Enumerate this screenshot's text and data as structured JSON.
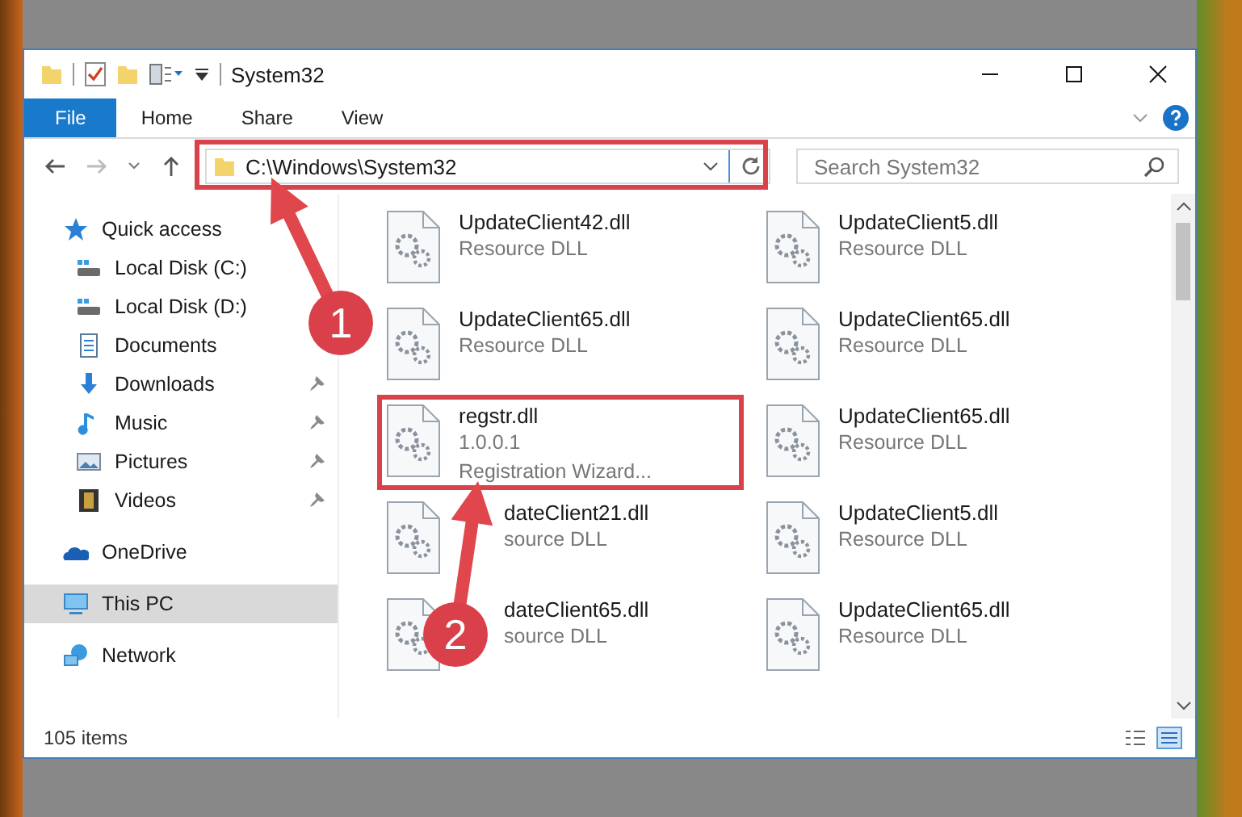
{
  "window": {
    "title": "System32"
  },
  "ribbon_tabs": [
    {
      "label": "File",
      "selected": true
    },
    {
      "label": "Home",
      "selected": false
    },
    {
      "label": "Share",
      "selected": false
    },
    {
      "label": "View",
      "selected": false
    }
  ],
  "address_bar": {
    "path": "C:\\Windows\\System32"
  },
  "search": {
    "placeholder": "Search System32"
  },
  "sidebar": {
    "items": [
      {
        "label": "Quick access",
        "kind": "star",
        "selected": false,
        "children": [
          {
            "label": "Local Disk (C:)",
            "kind": "drive",
            "pinned": false,
            "selected": false
          },
          {
            "label": "Local Disk (D:)",
            "kind": "drive",
            "pinned": false,
            "selected": false
          },
          {
            "label": "Documents",
            "kind": "documents",
            "pinned": false,
            "selected": false
          },
          {
            "label": "Downloads",
            "kind": "downloads",
            "pinned": true,
            "selected": false
          },
          {
            "label": "Music",
            "kind": "music",
            "pinned": true,
            "selected": false
          },
          {
            "label": "Pictures",
            "kind": "pictures",
            "pinned": true,
            "selected": false
          },
          {
            "label": "Videos",
            "kind": "videos",
            "pinned": true,
            "selected": false
          }
        ]
      },
      {
        "label": "OneDrive",
        "kind": "cloud",
        "selected": false
      },
      {
        "label": "This PC",
        "kind": "pc",
        "selected": true
      },
      {
        "label": "Network",
        "kind": "network",
        "selected": false
      }
    ]
  },
  "files": [
    {
      "name": "UpdateClient42.dll",
      "details": [
        "Resource DLL"
      ]
    },
    {
      "name": "UpdateClient5.dll",
      "details": [
        "Resource DLL"
      ]
    },
    {
      "name": "UpdateClient65.dll",
      "details": [
        "Resource DLL"
      ]
    },
    {
      "name": "UpdateClient65.dll",
      "details": [
        "Resource DLL"
      ]
    },
    {
      "name": "regstr.dll",
      "details": [
        "1.0.0.1",
        "Registration Wizard..."
      ]
    },
    {
      "name": "UpdateClient65.dll",
      "details": [
        "Resource DLL"
      ]
    },
    {
      "name": "dateClient21.dll",
      "details": [
        "source DLL"
      ]
    },
    {
      "name": "UpdateClient5.dll",
      "details": [
        "Resource DLL"
      ]
    },
    {
      "name": "dateClient65.dll",
      "details": [
        "source DLL"
      ]
    },
    {
      "name": "UpdateClient65.dll",
      "details": [
        "Resource DLL"
      ]
    }
  ],
  "status_bar": {
    "item_count": "105 items"
  },
  "annotations": [
    {
      "number": "1"
    },
    {
      "number": "2"
    }
  ]
}
